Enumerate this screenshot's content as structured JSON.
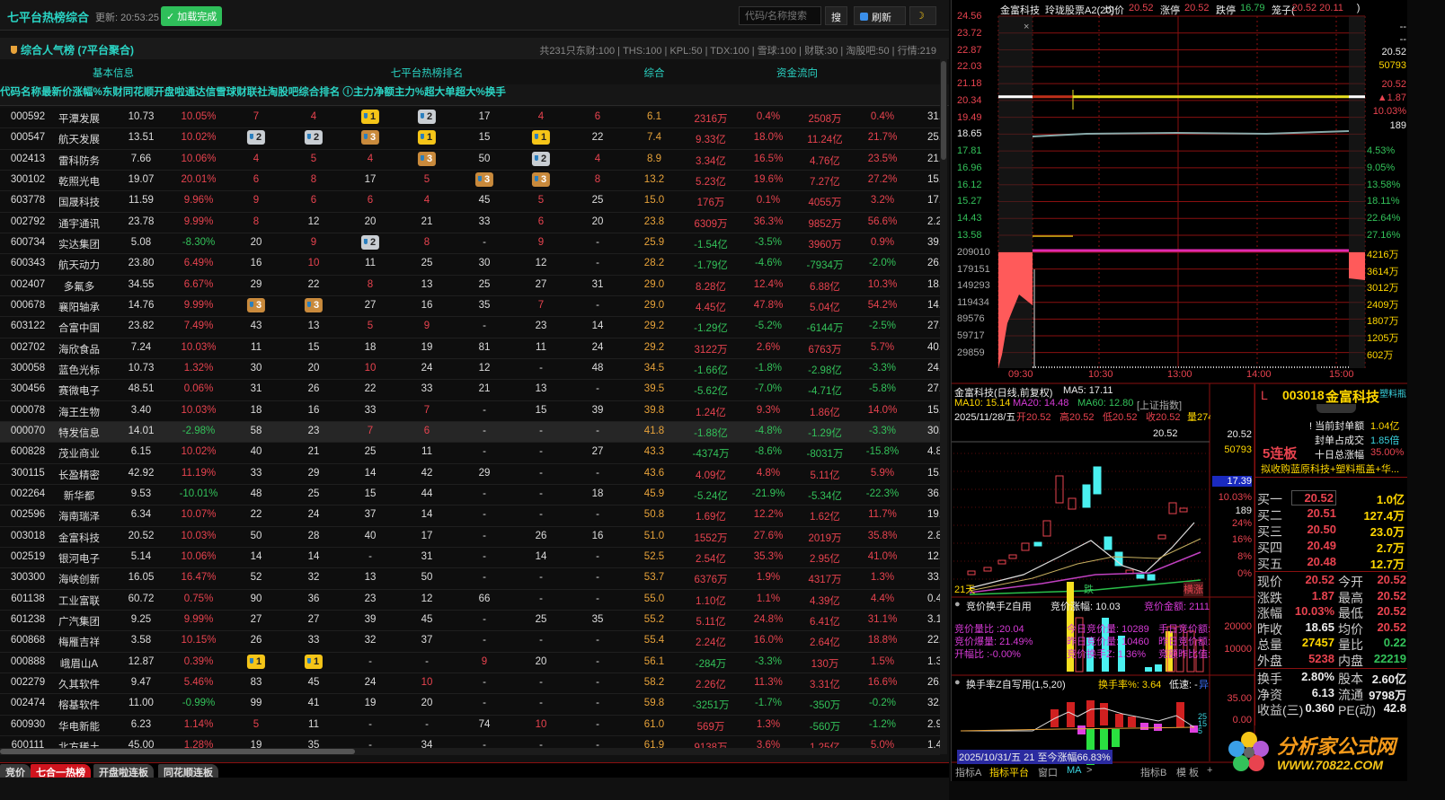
{
  "app": {
    "title": "七平台热榜综合",
    "update": "更新: 20:53:25",
    "loaded": "✓ 加载完成",
    "search_placeholder": "代码/名称搜索",
    "search_btn": "搜",
    "refresh": "刷新",
    "theme_icon": "moon-icon"
  },
  "board": {
    "title": "综合人气榜 (7平台聚合)",
    "info": "共231只东财:100 | THS:100 | KPL:50 | TDX:100 | 雪球:100 | 财联:30 | 淘股吧:50 | 行情:219"
  },
  "groups": [
    "基本信息",
    "七平台热榜排名",
    "综合",
    "资金流向"
  ],
  "columns": [
    "代码",
    "名称",
    "最新价",
    "涨幅%",
    "东财",
    "同花顺",
    "开盘啦",
    "通达信",
    "雪球",
    "财联社",
    "淘股吧",
    "综合排名 ⓘ",
    "主力净额",
    "主力%",
    "超大单",
    "超大%",
    "换手"
  ],
  "rows": [
    [
      "000592",
      "平潭发展",
      "10.73",
      "10.05%",
      "7",
      "4",
      "1",
      "2",
      "17",
      "4",
      "6",
      "6.1",
      "2316万",
      "0.4%",
      "2508万",
      "0.4%",
      "31."
    ],
    [
      "000547",
      "航天发展",
      "13.51",
      "10.02%",
      "2",
      "2",
      "3",
      "1",
      "15",
      "1",
      "22",
      "7.4",
      "9.33亿",
      "18.0%",
      "11.24亿",
      "21.7%",
      "25."
    ],
    [
      "002413",
      "雷科防务",
      "7.66",
      "10.06%",
      "4",
      "5",
      "4",
      "3",
      "50",
      "2",
      "4",
      "8.9",
      "3.34亿",
      "16.5%",
      "4.76亿",
      "23.5%",
      "21."
    ],
    [
      "300102",
      "乾照光电",
      "19.07",
      "20.01%",
      "6",
      "8",
      "17",
      "5",
      "3",
      "3",
      "8",
      "13.2",
      "5.23亿",
      "19.6%",
      "7.27亿",
      "27.2%",
      "15."
    ],
    [
      "603778",
      "国晟科技",
      "11.59",
      "9.96%",
      "9",
      "6",
      "6",
      "4",
      "45",
      "5",
      "25",
      "15.0",
      "176万",
      "0.1%",
      "4055万",
      "3.2%",
      "17."
    ],
    [
      "002792",
      "通宇通讯",
      "23.78",
      "9.99%",
      "8",
      "12",
      "20",
      "21",
      "33",
      "6",
      "20",
      "23.8",
      "6309万",
      "36.3%",
      "9852万",
      "56.6%",
      "2.2"
    ],
    [
      "600734",
      "实达集团",
      "5.08",
      "-8.30%",
      "20",
      "9",
      "2",
      "8",
      "-",
      "9",
      "-",
      "25.9",
      "-1.54亿",
      "-3.5%",
      "3960万",
      "0.9%",
      "39."
    ],
    [
      "600343",
      "航天动力",
      "23.80",
      "6.49%",
      "16",
      "10",
      "11",
      "25",
      "30",
      "12",
      "-",
      "28.2",
      "-1.79亿",
      "-4.6%",
      "-7934万",
      "-2.0%",
      "26."
    ],
    [
      "002407",
      "多氟多",
      "34.55",
      "6.67%",
      "29",
      "22",
      "8",
      "13",
      "25",
      "27",
      "31",
      "29.0",
      "8.28亿",
      "12.4%",
      "6.88亿",
      "10.3%",
      "18."
    ],
    [
      "000678",
      "襄阳轴承",
      "14.76",
      "9.99%",
      "3",
      "3",
      "27",
      "16",
      "35",
      "7",
      "-",
      "29.0",
      "4.45亿",
      "47.8%",
      "5.04亿",
      "54.2%",
      "14."
    ],
    [
      "603122",
      "合富中国",
      "23.82",
      "7.49%",
      "43",
      "13",
      "5",
      "9",
      "-",
      "23",
      "14",
      "29.2",
      "-1.29亿",
      "-5.2%",
      "-6144万",
      "-2.5%",
      "27."
    ],
    [
      "002702",
      "海欣食品",
      "7.24",
      "10.03%",
      "11",
      "15",
      "18",
      "19",
      "81",
      "11",
      "24",
      "29.2",
      "3122万",
      "2.6%",
      "6763万",
      "5.7%",
      "40."
    ],
    [
      "300058",
      "蓝色光标",
      "10.73",
      "1.32%",
      "30",
      "20",
      "10",
      "24",
      "12",
      "-",
      "48",
      "34.5",
      "-1.66亿",
      "-1.8%",
      "-2.98亿",
      "-3.3%",
      "24."
    ],
    [
      "300456",
      "赛微电子",
      "48.51",
      "0.06%",
      "31",
      "26",
      "22",
      "33",
      "21",
      "13",
      "-",
      "39.5",
      "-5.62亿",
      "-7.0%",
      "-4.71亿",
      "-5.8%",
      "27."
    ],
    [
      "000078",
      "海王生物",
      "3.40",
      "10.03%",
      "18",
      "16",
      "33",
      "7",
      "-",
      "15",
      "39",
      "39.8",
      "1.24亿",
      "9.3%",
      "1.86亿",
      "14.0%",
      "15."
    ],
    [
      "000070",
      "特发信息",
      "14.01",
      "-2.98%",
      "58",
      "23",
      "7",
      "6",
      "-",
      "-",
      "-",
      "41.8",
      "-1.88亿",
      "-4.8%",
      "-1.29亿",
      "-3.3%",
      "30."
    ],
    [
      "600828",
      "茂业商业",
      "6.15",
      "10.02%",
      "40",
      "21",
      "25",
      "11",
      "-",
      "-",
      "27",
      "43.3",
      "-4374万",
      "-8.6%",
      "-8031万",
      "-15.8%",
      "4.8"
    ],
    [
      "300115",
      "长盈精密",
      "42.92",
      "11.19%",
      "33",
      "29",
      "14",
      "42",
      "29",
      "-",
      "-",
      "43.6",
      "4.09亿",
      "4.8%",
      "5.11亿",
      "5.9%",
      "15."
    ],
    [
      "002264",
      "新华都",
      "9.53",
      "-10.01%",
      "48",
      "25",
      "15",
      "44",
      "-",
      "-",
      "18",
      "45.9",
      "-5.24亿",
      "-21.9%",
      "-5.34亿",
      "-22.3%",
      "36."
    ],
    [
      "002596",
      "海南瑞泽",
      "6.34",
      "10.07%",
      "22",
      "24",
      "37",
      "14",
      "-",
      "-",
      "-",
      "50.8",
      "1.69亿",
      "12.2%",
      "1.62亿",
      "11.7%",
      "19."
    ],
    [
      "003018",
      "金富科技",
      "20.52",
      "10.03%",
      "50",
      "28",
      "40",
      "17",
      "-",
      "26",
      "16",
      "51.0",
      "1552万",
      "27.6%",
      "2019万",
      "35.8%",
      "2.8"
    ],
    [
      "002519",
      "银河电子",
      "5.14",
      "10.06%",
      "14",
      "14",
      "-",
      "31",
      "-",
      "14",
      "-",
      "52.5",
      "2.54亿",
      "35.3%",
      "2.95亿",
      "41.0%",
      "12."
    ],
    [
      "300300",
      "海峡创新",
      "16.05",
      "16.47%",
      "52",
      "32",
      "13",
      "50",
      "-",
      "-",
      "-",
      "53.7",
      "6376万",
      "1.9%",
      "4317万",
      "1.3%",
      "33."
    ],
    [
      "601138",
      "工业富联",
      "60.72",
      "0.75%",
      "90",
      "36",
      "23",
      "12",
      "66",
      "-",
      "-",
      "55.0",
      "1.10亿",
      "1.1%",
      "4.39亿",
      "4.4%",
      "0.4"
    ],
    [
      "601238",
      "广汽集团",
      "9.25",
      "9.99%",
      "27",
      "27",
      "39",
      "45",
      "-",
      "25",
      "35",
      "55.2",
      "5.11亿",
      "24.8%",
      "6.41亿",
      "31.1%",
      "3.1"
    ],
    [
      "600868",
      "梅雁吉祥",
      "3.58",
      "10.15%",
      "26",
      "33",
      "32",
      "37",
      "-",
      "-",
      "-",
      "55.4",
      "2.24亿",
      "16.0%",
      "2.64亿",
      "18.8%",
      "22."
    ],
    [
      "000888",
      "峨眉山A",
      "12.87",
      "0.39%",
      "1",
      "1",
      "-",
      "-",
      "9",
      "20",
      "-",
      "56.1",
      "-284万",
      "-3.3%",
      "130万",
      "1.5%",
      "1.3"
    ],
    [
      "002279",
      "久其软件",
      "9.47",
      "5.46%",
      "83",
      "45",
      "24",
      "10",
      "-",
      "-",
      "-",
      "58.2",
      "2.26亿",
      "11.3%",
      "3.31亿",
      "16.6%",
      "26."
    ],
    [
      "002474",
      "榕基软件",
      "11.00",
      "-0.99%",
      "99",
      "41",
      "19",
      "20",
      "-",
      "-",
      "-",
      "59.8",
      "-3251万",
      "-1.7%",
      "-350万",
      "-0.2%",
      "32."
    ],
    [
      "600930",
      "华电新能",
      "6.23",
      "1.14%",
      "5",
      "11",
      "-",
      "-",
      "74",
      "10",
      "-",
      "61.0",
      "569万",
      "1.3%",
      "-560万",
      "-1.2%",
      "2.9"
    ],
    [
      "600111",
      "北方稀土",
      "45.00",
      "1.28%",
      "19",
      "35",
      "-",
      "34",
      "-",
      "-",
      "-",
      "61.9",
      "9138万",
      "3.6%",
      "1.25亿",
      "5.0%",
      "1.4"
    ]
  ],
  "highlight_row": "000070",
  "bottom_tabs": [
    "竞价",
    "七合一热榜",
    "开盘啦连板",
    "同花顺连板"
  ],
  "active_tab": "七合一热榜",
  "intraday": {
    "header": [
      {
        "t": "金富科技",
        "c": "w"
      },
      {
        "t": "玲珑股票A2(20)",
        "c": "w"
      },
      {
        "t": "均价",
        "c": "w"
      },
      {
        "t": "20.52",
        "c": "r"
      },
      {
        "t": "涨停",
        "c": "w"
      },
      {
        "t": "20.52",
        "c": "r"
      },
      {
        "t": "跌停",
        "c": "w"
      },
      {
        "t": "16.79",
        "c": "g"
      },
      {
        "t": "笼子(",
        "c": "w"
      },
      {
        "t": "20.52 20.11",
        "c": "r"
      },
      {
        "t": ")",
        "c": "w"
      }
    ],
    "price_axis": [
      "24.56",
      "23.72",
      "22.87",
      "22.03",
      "21.18",
      "20.34",
      "19.49",
      "18.65",
      "17.81",
      "16.96",
      "16.12",
      "15.27",
      "14.43",
      "13.58"
    ],
    "volume_axis": [
      "209010",
      "179151",
      "149293",
      "119434",
      "89576",
      "59717",
      "29859"
    ],
    "pct_axis": [
      "4.53%",
      "9.05%",
      "13.58%",
      "18.11%",
      "22.64%",
      "27.16%"
    ],
    "amount_axis": [
      "4216万",
      "3614万",
      "3012万",
      "2409万",
      "1807万",
      "1205万",
      "602万"
    ],
    "side_values": [
      "--",
      "--",
      "20.52",
      "50793",
      "20.52",
      "▲1.87",
      "10.03%",
      "189"
    ],
    "time_axis": [
      "09:30",
      "10:30",
      "13:00",
      "14:00",
      "15:00"
    ],
    "last_price": 20.52,
    "prev_close": 18.65
  },
  "kline": {
    "title": "金富科技(日线,前复权)",
    "ma5": "MA5: 17.11",
    "ma10": "MA10: 15.14",
    "ma20": "MA20: 14.48",
    "ma60": "MA60: 12.80",
    "index": "[上证指数]",
    "date": "2025/11/28/五",
    "open": "开20.52",
    "high": "高20.52",
    "low": "低20.52",
    "close": "收20.52",
    "vol": "量27457",
    "price_tag": "20.52",
    "days": "21天",
    "down_tag": "跌",
    "up_tag": "横涨",
    "axis": [
      "20.52",
      "50793",
      "17.39",
      "10.03%",
      "189",
      "24%",
      "16%",
      "8%",
      "0%",
      "20000",
      "10000",
      "35.00",
      "0.00"
    ]
  },
  "ind1": {
    "name": "竞价换手Z自用",
    "auction_pct": "竞价涨幅: 10.03",
    "auction_amt": "竞价金额: 2111.23",
    "l1": "竞价量比 :20.04",
    "l2": "竞价爆量: 21.49%",
    "l3": "开幅比  :-0.00%",
    "m1": "今日竞价量: 10289",
    "m2": "昨日竞价量: 10460",
    "m3": "竞价换手Z: 1.36%",
    "r1": "手日竞价额: 211",
    "r2": "昨日竞价额: 195",
    "r3": "竞额昨比值: 1.0"
  },
  "ind2": {
    "name": "换手率Z自写用(1,5,20)",
    "turn": "换手率%: 3.64",
    "speed": "低速: -",
    "abn": "异动: 3.0",
    "levels": [
      "25",
      "15",
      "5"
    ]
  },
  "range_bar": "2025/10/31/五 21 至今涨幅66.83%",
  "chart_tabs": [
    "指标A",
    "指标平台",
    "窗口",
    "MA",
    ">",
    "指标B",
    "模 板",
    "+"
  ],
  "quote": {
    "flag": "L",
    "code": "003018",
    "name": "金富科技",
    "tag": "塑料瓶",
    "seal_amt_label": "! 当前封单额",
    "seal_amt": "1.04亿",
    "seal_ratio_label": "封单占成交",
    "seal_ratio": "1.85倍",
    "ten_day_label": "十日总涨幅",
    "ten_day": "35.00%",
    "streak": "5连板",
    "concept": "拟收购蓝原科技+塑料瓶盖+华...",
    "bids": [
      [
        "买一",
        "20.52",
        "1.0亿"
      ],
      [
        "买二",
        "20.51",
        "127.4万"
      ],
      [
        "买三",
        "20.50",
        "23.0万"
      ],
      [
        "买四",
        "20.49",
        "2.7万"
      ],
      [
        "买五",
        "20.48",
        "12.7万"
      ]
    ],
    "stats": [
      [
        "现价",
        "20.52",
        "r",
        "今开",
        "20.52",
        "r"
      ],
      [
        "涨跌",
        "1.87",
        "r",
        "最高",
        "20.52",
        "r"
      ],
      [
        "涨幅",
        "10.03%",
        "r",
        "最低",
        "20.52",
        "r"
      ],
      [
        "昨收",
        "18.65",
        "w",
        "均价",
        "20.52",
        "r"
      ],
      [
        "总量",
        "27457",
        "y",
        "量比",
        "0.22",
        "g"
      ],
      [
        "外盘",
        "5238",
        "r",
        "内盘",
        "22219",
        "g"
      ]
    ],
    "fund": [
      [
        "换手",
        "2.80%",
        "股本",
        "2.60亿"
      ],
      [
        "净资",
        "6.13",
        "流通",
        "9798万"
      ],
      [
        "收益(三)",
        "0.360",
        "PE(动)",
        "42.8"
      ]
    ]
  },
  "watermark": {
    "name": "分析家公式网",
    "url": "WWW.70822.COM"
  },
  "colors": {
    "up": "#e8434f",
    "down": "#33c25a",
    "accent": "#2ad4c4",
    "score": "#e8a33a",
    "grid": "#8a1010"
  }
}
